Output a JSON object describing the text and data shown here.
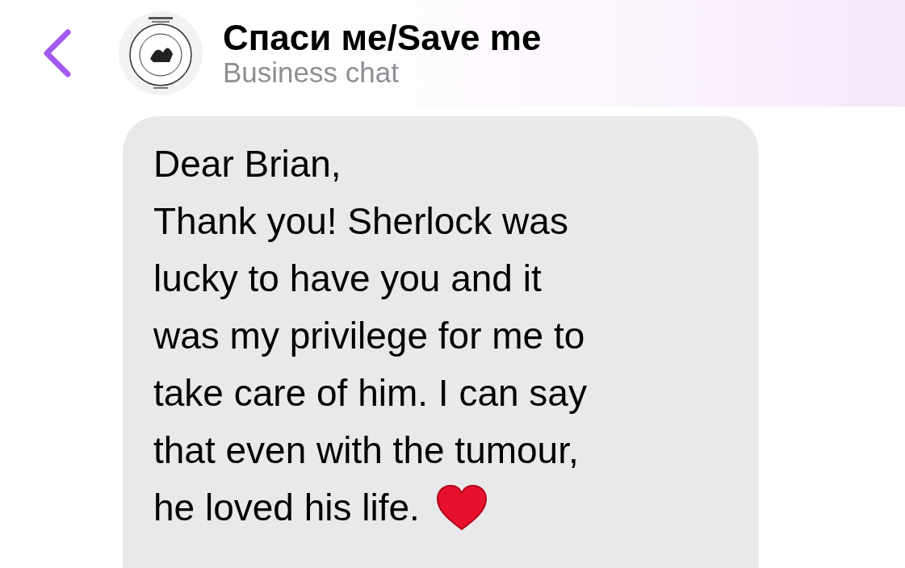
{
  "header": {
    "title": "Спаси ме/Save me",
    "subtitle": "Business chat"
  },
  "message": {
    "incoming": true,
    "lines": [
      "Dear Brian,",
      "Thank you! Sherlock was",
      "lucky to have you and it",
      "was my privilege for me to",
      "take care of him. I can say",
      "that even with the tumour,",
      "he loved his life."
    ]
  }
}
